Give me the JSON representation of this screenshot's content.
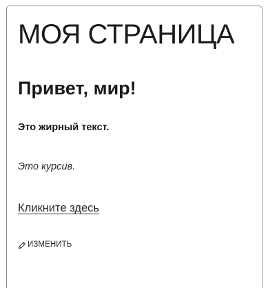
{
  "page": {
    "title": "МОЯ СТРАНИЦА"
  },
  "content": {
    "heading": "Привет, мир!",
    "bold_text": "Это жирный текст.",
    "italic_text": "Это курсив.",
    "link_text": "Кликните здесь"
  },
  "actions": {
    "edit_label": "ИЗМЕНИТЬ",
    "edit_icon": "pencil-icon"
  }
}
